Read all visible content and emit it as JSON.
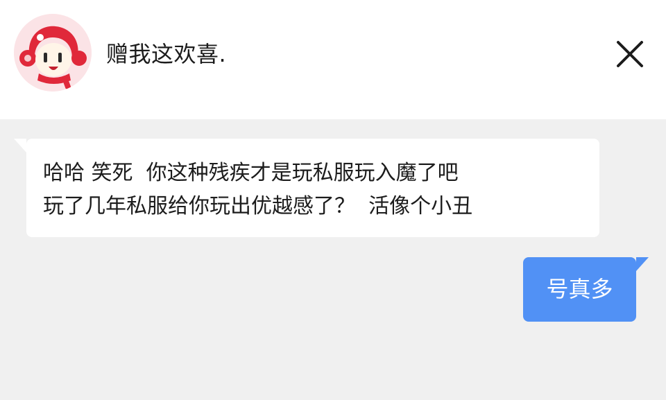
{
  "header": {
    "contact_name": "赠我这欢喜.",
    "avatar_icon": "cartoon-avatar-icon",
    "close_icon": "close-icon"
  },
  "messages": [
    {
      "direction": "incoming",
      "lines": [
        "哈哈 笑死  你这种残疾才是玩私服玩入魔了吧",
        "玩了几年私服给你玩出优越感了？  活像个小丑"
      ]
    },
    {
      "direction": "outgoing",
      "text": "号真多"
    }
  ],
  "colors": {
    "header_bg": "#ffffff",
    "chat_bg": "#f0f0f0",
    "incoming_bubble": "#ffffff",
    "outgoing_bubble": "#5191f5",
    "outgoing_text": "#ffffff"
  }
}
